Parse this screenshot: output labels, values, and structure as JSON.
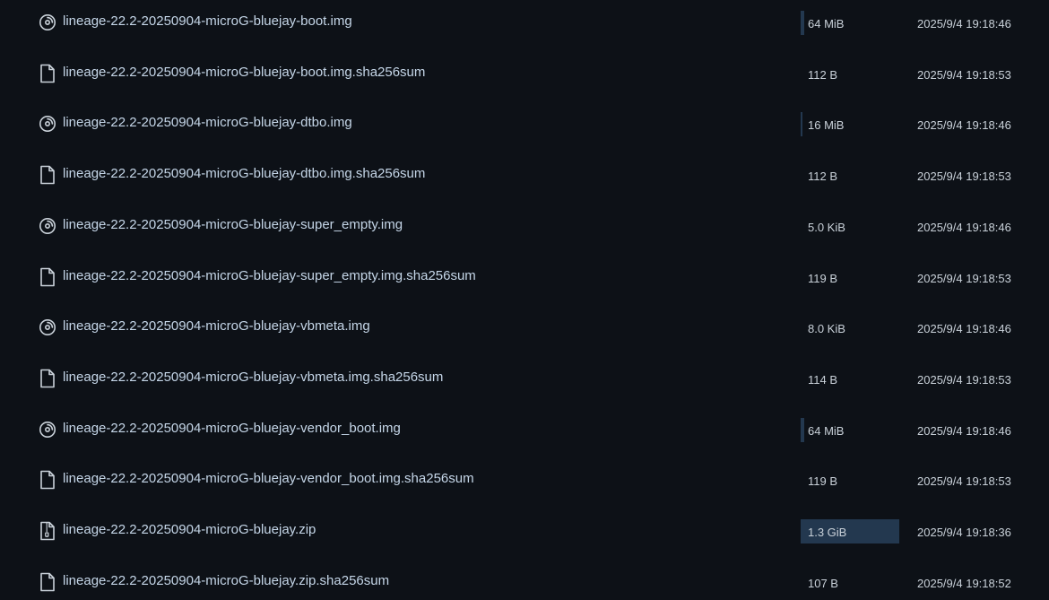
{
  "files": [
    {
      "name": "lineage-22.2-20250904-microG-bluejay-boot.img",
      "icon": "disc-icon",
      "size": "64 MiB",
      "size_fraction": 0.035,
      "date": "2025/9/4 19:18:46"
    },
    {
      "name": "lineage-22.2-20250904-microG-bluejay-boot.img.sha256sum",
      "icon": "file-icon",
      "size": "112 B",
      "size_fraction": 0,
      "date": "2025/9/4 19:18:53"
    },
    {
      "name": "lineage-22.2-20250904-microG-bluejay-dtbo.img",
      "icon": "disc-icon",
      "size": "16 MiB",
      "size_fraction": 0.012,
      "date": "2025/9/4 19:18:46"
    },
    {
      "name": "lineage-22.2-20250904-microG-bluejay-dtbo.img.sha256sum",
      "icon": "file-icon",
      "size": "112 B",
      "size_fraction": 0,
      "date": "2025/9/4 19:18:53"
    },
    {
      "name": "lineage-22.2-20250904-microG-bluejay-super_empty.img",
      "icon": "disc-icon",
      "size": "5.0 KiB",
      "size_fraction": 0,
      "date": "2025/9/4 19:18:46"
    },
    {
      "name": "lineage-22.2-20250904-microG-bluejay-super_empty.img.sha256sum",
      "icon": "file-icon",
      "size": "119 B",
      "size_fraction": 0,
      "date": "2025/9/4 19:18:53"
    },
    {
      "name": "lineage-22.2-20250904-microG-bluejay-vbmeta.img",
      "icon": "disc-icon",
      "size": "8.0 KiB",
      "size_fraction": 0,
      "date": "2025/9/4 19:18:46"
    },
    {
      "name": "lineage-22.2-20250904-microG-bluejay-vbmeta.img.sha256sum",
      "icon": "file-icon",
      "size": "114 B",
      "size_fraction": 0,
      "date": "2025/9/4 19:18:53"
    },
    {
      "name": "lineage-22.2-20250904-microG-bluejay-vendor_boot.img",
      "icon": "disc-icon",
      "size": "64 MiB",
      "size_fraction": 0.035,
      "date": "2025/9/4 19:18:46"
    },
    {
      "name": "lineage-22.2-20250904-microG-bluejay-vendor_boot.img.sha256sum",
      "icon": "file-icon",
      "size": "119 B",
      "size_fraction": 0,
      "date": "2025/9/4 19:18:53"
    },
    {
      "name": "lineage-22.2-20250904-microG-bluejay.zip",
      "icon": "zip-icon",
      "size": "1.3 GiB",
      "size_fraction": 1,
      "date": "2025/9/4 19:18:36"
    },
    {
      "name": "lineage-22.2-20250904-microG-bluejay.zip.sha256sum",
      "icon": "file-icon",
      "size": "107 B",
      "size_fraction": 0,
      "date": "2025/9/4 19:18:52"
    }
  ],
  "colors": {
    "background": "#0d1117",
    "link": "#c5d6e8",
    "text": "#c9d1d9",
    "size_bar": "#23384f"
  }
}
